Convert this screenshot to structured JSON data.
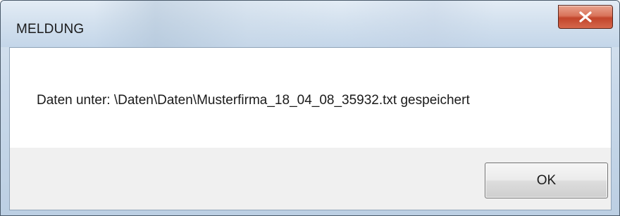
{
  "window": {
    "title": "MELDUNG",
    "close_icon": "close-x-icon"
  },
  "dialog": {
    "message": "Daten unter: \\Daten\\Daten\\Musterfirma_18_04_08_35932.txt gespeichert",
    "ok_label": "OK"
  },
  "colors": {
    "titlebar": "#d2e0ee",
    "close_button": "#c2452b",
    "content_background": "#ffffff",
    "footer_background": "#f0f0f0"
  }
}
